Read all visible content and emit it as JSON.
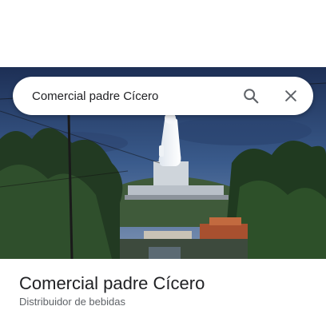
{
  "search": {
    "query": "Comercial padre Cícero",
    "search_icon": "search-icon",
    "close_icon": "close-icon"
  },
  "place": {
    "title": "Comercial padre Cícero",
    "category": "Distribuidor de bebidas"
  },
  "colors": {
    "title_text": "#202124",
    "secondary_text": "#5f6368",
    "icon": "#5f6368",
    "sky": "#2a3f66"
  }
}
